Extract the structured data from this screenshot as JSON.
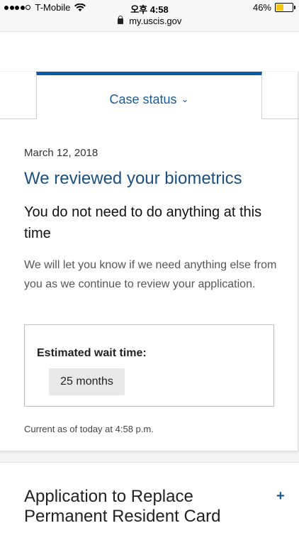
{
  "status_bar": {
    "carrier": "T-Mobile",
    "time": "오후 4:58",
    "battery": "46%",
    "battery_level": 0.46
  },
  "browser": {
    "url": "my.uscis.gov"
  },
  "tab": {
    "label": "Case status"
  },
  "case": {
    "date": "March 12, 2018",
    "headline": "We reviewed your biometrics",
    "subhead": "You do not need to do anything at this time",
    "body": "We will let you know if we need anything else from you as we continue to review your application.",
    "wait_label": "Estimated wait time:",
    "wait_value": "25 months",
    "current_as_of": "Current as of today at 4:58 p.m."
  },
  "application": {
    "title": "Application to Replace Permanent Resident Card"
  },
  "colors": {
    "accent": "#0b5aa5",
    "headline": "#1a4f80",
    "battery": "#f5c518"
  }
}
